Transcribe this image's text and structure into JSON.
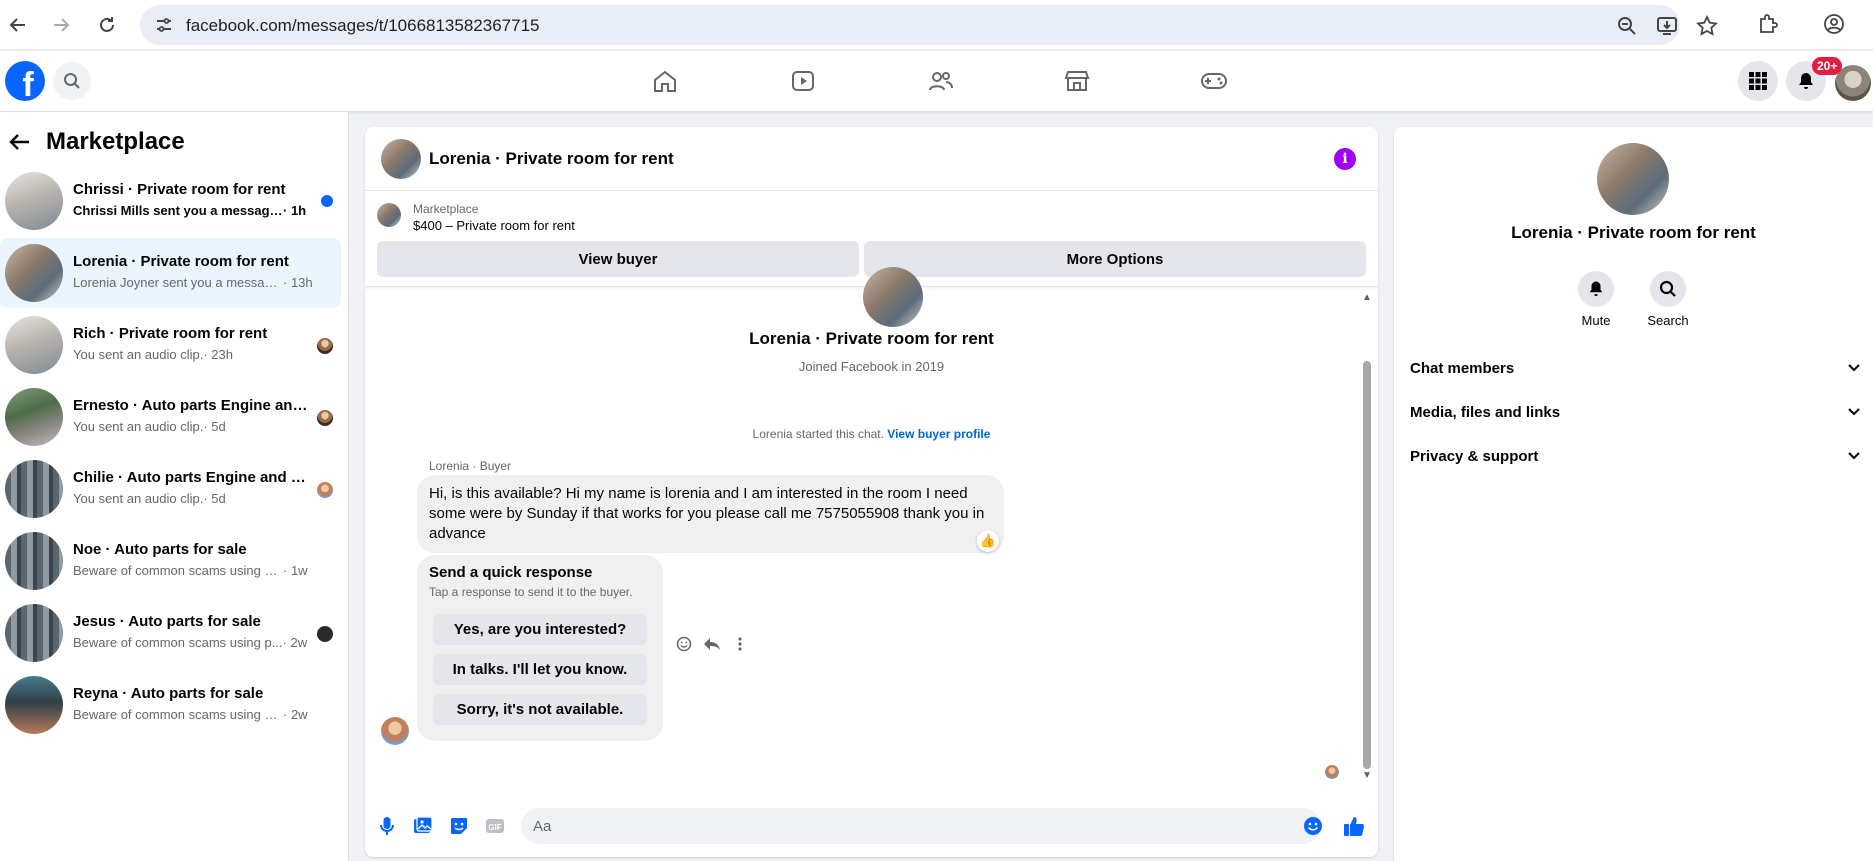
{
  "browser": {
    "url": "facebook.com/messages/t/1066813582367715"
  },
  "header": {
    "logo": "f",
    "notification_count": "20+"
  },
  "sidebar": {
    "title": "Marketplace",
    "conversations": [
      {
        "name": "Chrissi · Private room for rent",
        "snippet": "Chrissi Mills sent you a message a...",
        "time": " · 1h",
        "unread": true
      },
      {
        "name": "Lorenia · Private room for rent",
        "snippet": "Lorenia Joyner sent you a message a...",
        "time": " · 13h",
        "active": true
      },
      {
        "name": "Rich · Private room for rent",
        "snippet": "You sent an audio clip.",
        "time": " · 23h"
      },
      {
        "name": "Ernesto · Auto parts Engine and ...",
        "snippet": "You sent an audio clip.",
        "time": " · 5d"
      },
      {
        "name": "Chilie · Auto parts Engine and Tr...",
        "snippet": "You sent an audio clip.",
        "time": " · 5d"
      },
      {
        "name": "Noe · Auto parts for sale",
        "snippet": "Beware of common scams using pay...",
        "time": " · 1w"
      },
      {
        "name": "Jesus · Auto parts for sale",
        "snippet": "Beware of common scams using p...",
        "time": " · 2w"
      },
      {
        "name": "Reyna · Auto parts for sale",
        "snippet": "Beware of common scams using pay...",
        "time": " · 2w"
      }
    ]
  },
  "chat": {
    "title": "Lorenia · Private room for rent",
    "listing_source": "Marketplace",
    "listing_price": "$400 – Private room for rent",
    "view_buyer_label": "View buyer",
    "more_options_label": "More Options",
    "intro_name": "Lorenia · Private room for rent",
    "intro_sub": "Joined Facebook in 2019",
    "started_text": "Lorenia started this chat. ",
    "started_link": "View buyer profile",
    "sender_label": "Lorenia · Buyer",
    "message": "Hi, is this available? Hi my name is lorenia and I am interested in the room I need some were by Sunday if that works for you please call me 7575055908 thank you in advance",
    "reaction": "👍",
    "quick_response": {
      "title": "Send a quick response",
      "subtitle": "Tap a response to send it to the buyer.",
      "options": [
        "Yes, are you interested?",
        "In talks. I'll let you know.",
        "Sorry, it's not available."
      ]
    },
    "composer_placeholder": "Aa"
  },
  "right_panel": {
    "name": "Lorenia · Private room for rent",
    "mute_label": "Mute",
    "search_label": "Search",
    "sections": [
      "Chat members",
      "Media, files and links",
      "Privacy & support"
    ]
  },
  "colors": {
    "facebook_blue": "#0866ff",
    "active_row": "#ebf5ff",
    "info_purple": "#a100f2",
    "badge_red": "#e41e3f"
  }
}
